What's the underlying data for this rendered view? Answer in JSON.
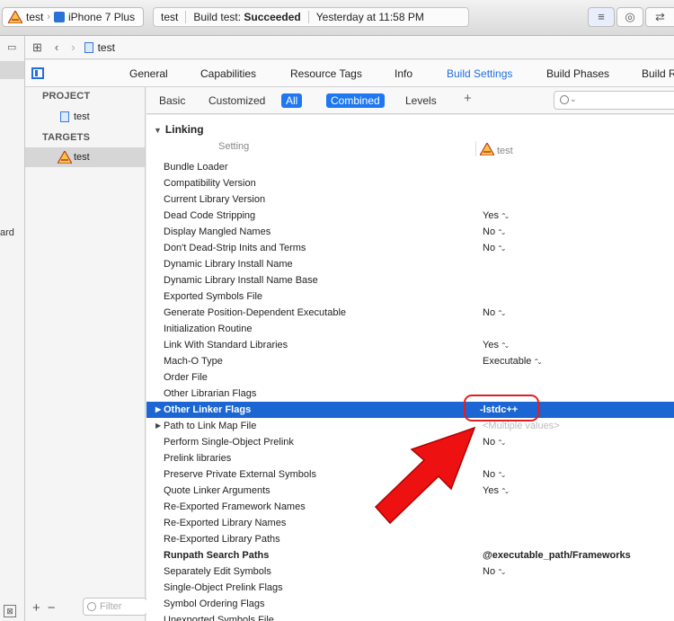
{
  "toolbar": {
    "scheme_project": "test",
    "scheme_device": "iPhone 7 Plus",
    "status_project": "test",
    "status_label": "Build test:",
    "status_result": "Succeeded",
    "status_time": "Yesterday at 11:58 PM"
  },
  "left_nav": {
    "partial_label": "ard"
  },
  "jump_bar": {
    "file": "test"
  },
  "tabs": [
    "General",
    "Capabilities",
    "Resource Tags",
    "Info",
    "Build Settings",
    "Build Phases",
    "Build R"
  ],
  "active_tab": "Build Settings",
  "sidebar": {
    "project_header": "PROJECT",
    "project_item": "test",
    "targets_header": "TARGETS",
    "target_item": "test",
    "filter_placeholder": "Filter"
  },
  "filter_bar": {
    "basic": "Basic",
    "customized": "Customized",
    "all": "All",
    "combined": "Combined",
    "levels": "Levels",
    "add": "+"
  },
  "settings": {
    "group": "Linking",
    "col_setting": "Setting",
    "col_target": "test",
    "rows": [
      {
        "name": "Bundle Loader",
        "value": ""
      },
      {
        "name": "Compatibility Version",
        "value": ""
      },
      {
        "name": "Current Library Version",
        "value": ""
      },
      {
        "name": "Dead Code Stripping",
        "value": "Yes"
      },
      {
        "name": "Display Mangled Names",
        "value": "No"
      },
      {
        "name": "Don't Dead-Strip Inits and Terms",
        "value": "No"
      },
      {
        "name": "Dynamic Library Install Name",
        "value": ""
      },
      {
        "name": "Dynamic Library Install Name Base",
        "value": ""
      },
      {
        "name": "Exported Symbols File",
        "value": ""
      },
      {
        "name": "Generate Position-Dependent Executable",
        "value": "No"
      },
      {
        "name": "Initialization Routine",
        "value": ""
      },
      {
        "name": "Link With Standard Libraries",
        "value": "Yes"
      },
      {
        "name": "Mach-O Type",
        "value": "Executable"
      },
      {
        "name": "Order File",
        "value": ""
      },
      {
        "name": "Other Librarian Flags",
        "value": ""
      },
      {
        "name": "Other Linker Flags",
        "value": "-lstdc++"
      },
      {
        "name": "Path to Link Map File",
        "value": "<Multiple values>"
      },
      {
        "name": "Perform Single-Object Prelink",
        "value": "No"
      },
      {
        "name": "Prelink libraries",
        "value": ""
      },
      {
        "name": "Preserve Private External Symbols",
        "value": "No"
      },
      {
        "name": "Quote Linker Arguments",
        "value": "Yes"
      },
      {
        "name": "Re-Exported Framework Names",
        "value": ""
      },
      {
        "name": "Re-Exported Library Names",
        "value": ""
      },
      {
        "name": "Re-Exported Library Paths",
        "value": ""
      },
      {
        "name": "Runpath Search Paths",
        "value": "@executable_path/Frameworks"
      },
      {
        "name": "Separately Edit Symbols",
        "value": "No"
      },
      {
        "name": "Single-Object Prelink Flags",
        "value": ""
      },
      {
        "name": "Symbol Ordering Flags",
        "value": ""
      },
      {
        "name": "Unexported Symbols File",
        "value": ""
      }
    ]
  },
  "colors": {
    "accent": "#1f77f2",
    "selection": "#1b66d2",
    "annotation": "#e02020"
  },
  "icons": [
    "app-icon",
    "phone-icon",
    "file-icon",
    "panel-icon",
    "search-icon",
    "comment-icon"
  ]
}
